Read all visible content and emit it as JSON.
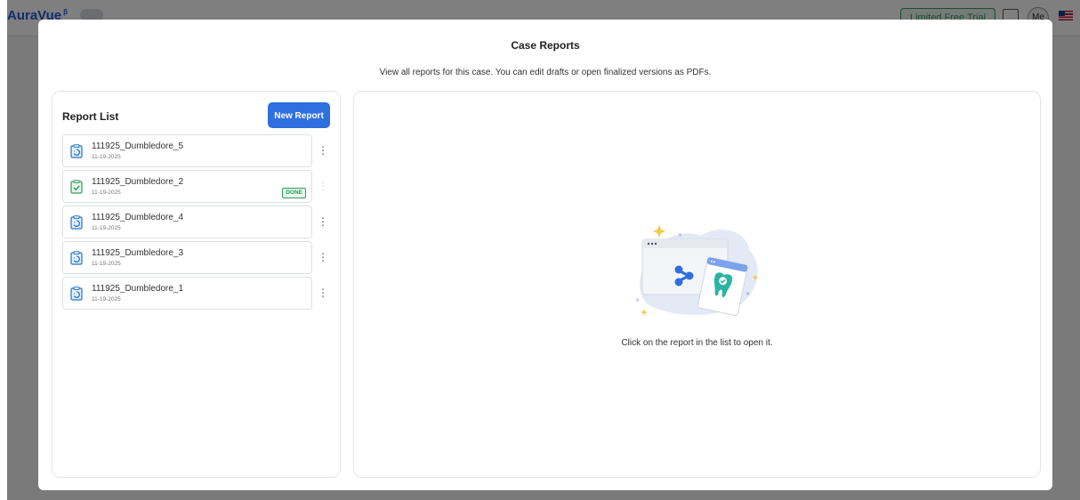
{
  "app": {
    "logo_text": "AuraVue",
    "logo_sup": "β",
    "trial_label": "Limited Free Trial",
    "avatar_text": "Me"
  },
  "modal": {
    "title": "Case Reports",
    "subtitle": "View all reports for this case. You can edit drafts or open finalized versions as PDFs."
  },
  "report_list": {
    "heading": "Report List",
    "new_button_label": "New Report",
    "menu_glyph": "⋮",
    "items": [
      {
        "name": "111925_Dumbledore_5",
        "date": "11-19-2025",
        "status": "draft",
        "badge": ""
      },
      {
        "name": "111925_Dumbledore_2",
        "date": "11-19-2025",
        "status": "done",
        "badge": "DONE"
      },
      {
        "name": "111925_Dumbledore_4",
        "date": "11-19-2025",
        "status": "draft",
        "badge": ""
      },
      {
        "name": "111925_Dumbledore_3",
        "date": "11-19-2025",
        "status": "draft",
        "badge": ""
      },
      {
        "name": "111925_Dumbledore_1",
        "date": "11-19-2025",
        "status": "draft",
        "badge": ""
      }
    ]
  },
  "viewer": {
    "empty_message": "Click on the report in the list to open it."
  },
  "colors": {
    "accent": "#2f6fe0",
    "done": "#2e9d58",
    "draft_icon": "#1e73c8"
  }
}
